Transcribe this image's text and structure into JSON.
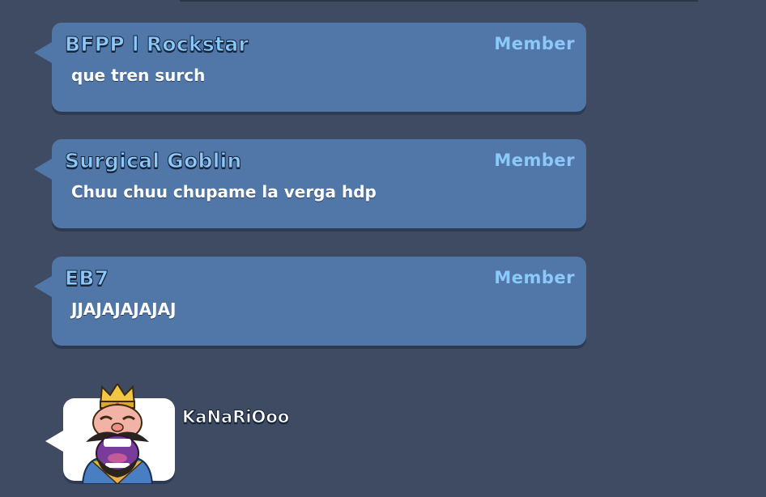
{
  "chat": {
    "messages": [
      {
        "sender": "BFPP l Rockstar",
        "role": "Member",
        "text": "que tren surch"
      },
      {
        "sender": "Surgical Goblin",
        "role": "Member",
        "text": "Chuu chuu chupame la verga hdp"
      },
      {
        "sender": "EB7",
        "role": "Member",
        "text": "JJAJAJAJAJAJ"
      }
    ],
    "emote_message": {
      "sender": "KaNaRiOoo",
      "emote": "king-laughing-emote"
    }
  },
  "colors": {
    "background": "#3e4b62",
    "bubble": "#5077a8",
    "name": "#8cc9fb",
    "text": "#ffffff"
  }
}
